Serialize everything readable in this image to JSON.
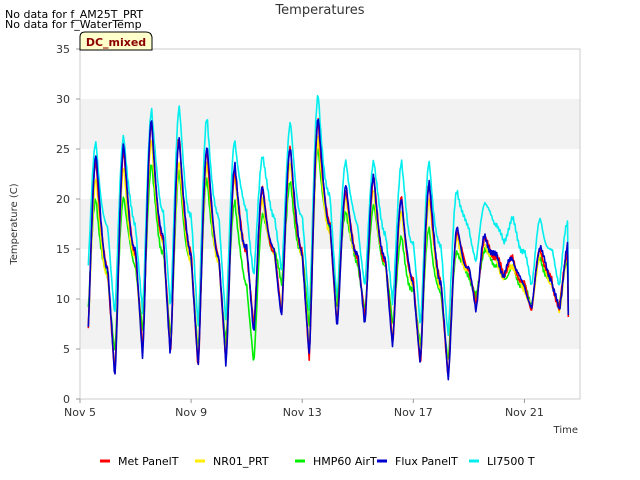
{
  "notes": [
    "No data for f_AM25T_PRT",
    "No data for f_WaterTemp"
  ],
  "badge": "DC_mixed",
  "chart_data": {
    "type": "line",
    "title": "Temperatures",
    "xlabel": "Time",
    "ylabel": "Temperature (C)",
    "x_range_days": [
      0,
      18
    ],
    "ylim": [
      0,
      35
    ],
    "yticks": [
      0,
      5,
      10,
      15,
      20,
      25,
      30,
      35
    ],
    "xticks": [
      {
        "day": 0,
        "label": "Nov 5"
      },
      {
        "day": 4,
        "label": "Nov 9"
      },
      {
        "day": 8,
        "label": "Nov 13"
      },
      {
        "day": 12,
        "label": "Nov 17"
      },
      {
        "day": 16,
        "label": "Nov 21"
      }
    ],
    "bands": [
      [
        5,
        10
      ],
      [
        15,
        20
      ],
      [
        25,
        30
      ]
    ],
    "legend_position": "bottom",
    "series": [
      {
        "name": "Met PanelT",
        "color": "#ff0000",
        "daily_min": [
          4.5,
          2.2,
          4.6,
          4.6,
          3.2,
          3.6,
          7.0,
          8.5,
          4.3,
          7.2,
          7.8,
          5.6,
          3.5,
          2.0,
          9.3,
          12.5,
          9.0
        ],
        "daily_max": [
          24.0,
          25.0,
          27.5,
          26.0,
          25.0,
          23.0,
          21.0,
          25.0,
          28.0,
          21.0,
          22.0,
          20.0,
          21.5,
          17.0,
          16.0,
          14.0,
          15.0
        ],
        "end_value": 8.2
      },
      {
        "name": "NR01_PRT",
        "color": "#ffee00",
        "daily_min": [
          5.0,
          2.8,
          5.0,
          5.0,
          3.8,
          4.2,
          7.5,
          9.0,
          5.0,
          7.8,
          8.2,
          6.0,
          4.0,
          2.5,
          9.5,
          12.0,
          8.8
        ],
        "daily_max": [
          22.0,
          23.0,
          26.0,
          24.0,
          23.5,
          22.0,
          20.0,
          24.0,
          26.0,
          20.0,
          21.0,
          19.0,
          20.0,
          16.0,
          15.5,
          13.5,
          14.5
        ],
        "end_value": 8.5
      },
      {
        "name": "HMP60 AirT",
        "color": "#00ee00",
        "daily_min": [
          7.5,
          4.5,
          6.5,
          6.0,
          5.0,
          5.5,
          3.3,
          11.5,
          7.5,
          9.0,
          8.5,
          7.5,
          5.5,
          3.8,
          10.0,
          12.0,
          9.5
        ],
        "daily_max": [
          20.0,
          20.5,
          23.5,
          22.5,
          22.0,
          20.0,
          18.5,
          21.5,
          25.0,
          19.0,
          19.5,
          16.0,
          17.0,
          15.0,
          15.0,
          13.0,
          14.0
        ],
        "end_value": 8.8
      },
      {
        "name": "Flux PanelT",
        "color": "#0000cc",
        "daily_min": [
          4.3,
          2.0,
          4.4,
          4.4,
          3.0,
          3.4,
          6.8,
          8.3,
          4.1,
          7.0,
          7.6,
          5.4,
          3.3,
          1.8,
          9.1,
          12.3,
          8.8
        ],
        "daily_max": [
          24.5,
          25.2,
          27.8,
          26.2,
          25.4,
          23.2,
          21.2,
          25.4,
          28.2,
          21.2,
          22.2,
          20.2,
          21.8,
          17.0,
          16.2,
          14.2,
          15.4
        ],
        "end_value": 8.4
      },
      {
        "name": "LI7500 T",
        "color": "#00eeee",
        "daily_min": [
          12.0,
          8.5,
          8.5,
          9.0,
          7.5,
          8.0,
          12.0,
          12.5,
          9.0,
          10.0,
          11.0,
          9.5,
          7.5,
          6.5,
          13.5,
          15.5,
          11.5
        ],
        "daily_max": [
          25.5,
          26.5,
          29.0,
          29.0,
          28.0,
          26.0,
          24.5,
          27.5,
          30.2,
          24.0,
          24.0,
          23.5,
          23.5,
          21.0,
          19.8,
          18.0,
          17.8
        ],
        "end_value": 11.8
      }
    ]
  }
}
